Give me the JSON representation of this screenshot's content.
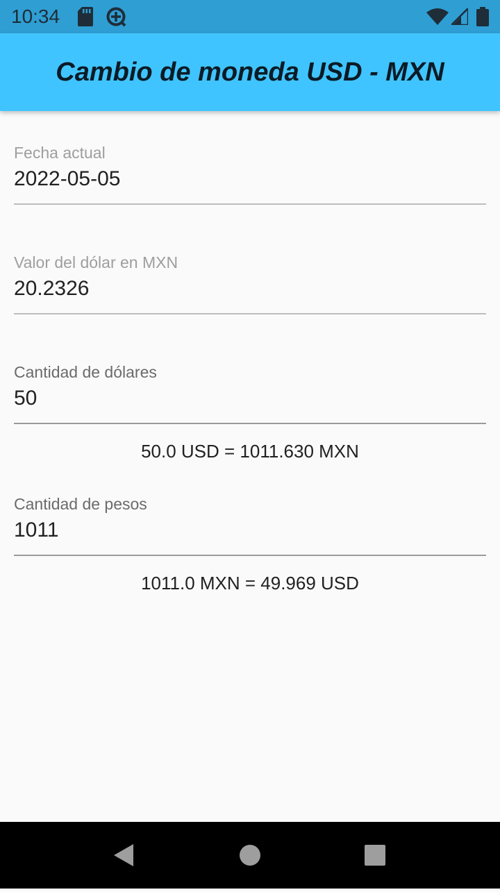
{
  "status_bar": {
    "time": "10:34",
    "icons": [
      "sd-card-icon",
      "data-saver-icon",
      "wifi-icon",
      "signal-icon",
      "battery-icon"
    ]
  },
  "app_bar": {
    "title": "Cambio de moneda USD - MXN",
    "color": "#40c4ff"
  },
  "fields": {
    "date": {
      "label": "Fecha actual",
      "value": "2022-05-05"
    },
    "rate": {
      "label": "Valor del dólar en MXN",
      "value": "20.2326"
    },
    "dollars": {
      "label": "Cantidad de dólares",
      "value": "50"
    },
    "pesos": {
      "label": "Cantidad de pesos",
      "value": "1011"
    }
  },
  "results": {
    "usd_to_mxn": "50.0 USD = 1011.630 MXN",
    "mxn_to_usd": "1011.0 MXN = 49.969 USD"
  },
  "nav_bar": {
    "buttons": [
      "back-icon",
      "home-icon",
      "recents-icon"
    ]
  }
}
